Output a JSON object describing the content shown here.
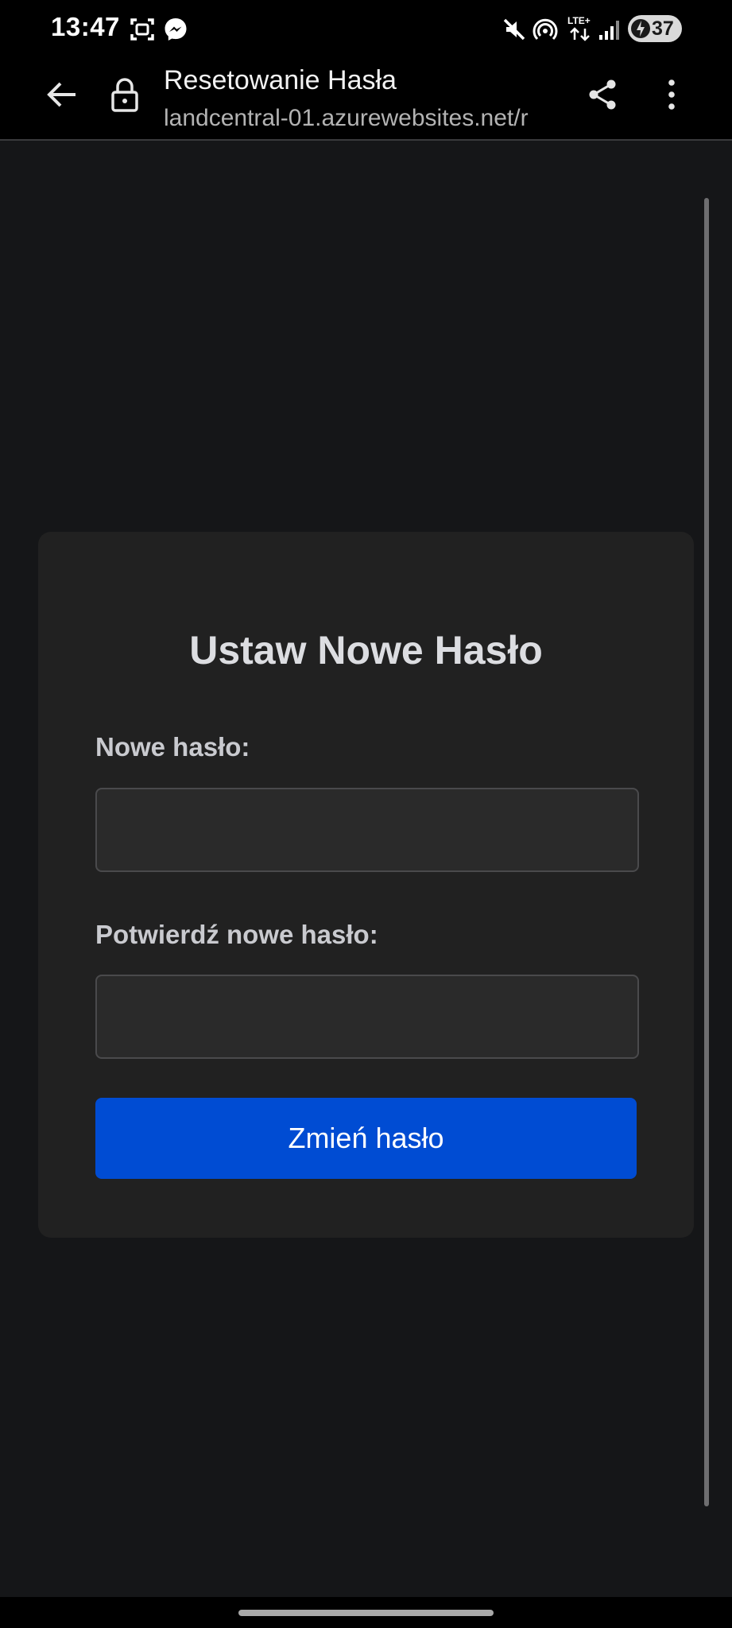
{
  "status_bar": {
    "time": "13:47",
    "battery_level": "37",
    "network_label": "LTE+",
    "left_icons": [
      "screenshot-icon",
      "messenger-icon"
    ],
    "right_icons": [
      "mute-icon",
      "hotspot-icon",
      "lte-icon",
      "signal-icon",
      "battery-charging-icon"
    ]
  },
  "browser": {
    "page_title": "Resetowanie Hasła",
    "url": "landcentral-01.azurewebsites.net/r",
    "icons": [
      "back-arrow-icon",
      "lock-icon",
      "share-icon",
      "more-vert-icon"
    ]
  },
  "form": {
    "heading": "Ustaw Nowe Hasło",
    "new_password_label": "Nowe hasło:",
    "new_password_value": "",
    "confirm_password_label": "Potwierdź nowe hasło:",
    "confirm_password_value": "",
    "submit_label": "Zmień hasło"
  },
  "colors": {
    "background": "#151618",
    "card": "#212121",
    "input": "#2a2a2a",
    "accent": "#004cd3"
  }
}
